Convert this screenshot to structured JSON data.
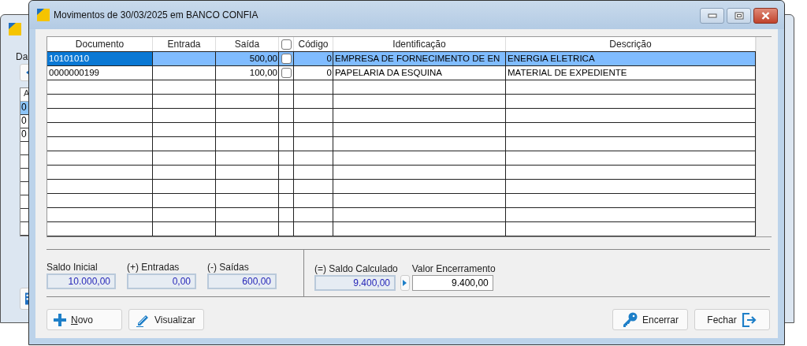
{
  "background_window": {
    "label": "Da",
    "column_header": "A",
    "rows": [
      {
        "cell": "0",
        "selected": true
      },
      {
        "cell": "0",
        "selected": false
      },
      {
        "cell": "0",
        "selected": false
      }
    ]
  },
  "window": {
    "title": "Movimentos de 30/03/2025 em BANCO CONFIA"
  },
  "table": {
    "header_checkbox": {
      "checked": false
    },
    "columns": [
      {
        "kind": "text",
        "label": "Documento"
      },
      {
        "kind": "text",
        "label": "Entrada"
      },
      {
        "kind": "text",
        "label": "Saída"
      },
      {
        "kind": "checkbox"
      },
      {
        "kind": "text",
        "label": "Código"
      },
      {
        "kind": "text",
        "label": "Identificação"
      },
      {
        "kind": "text",
        "label": "Descrição"
      }
    ],
    "rows": [
      {
        "selected": true,
        "documento": "10101010",
        "entrada": "",
        "saida": "500,00",
        "checked": false,
        "codigo": "0",
        "identificacao": "EMPRESA DE FORNECIMENTO DE EN",
        "descricao": "ENERGIA ELETRICA"
      },
      {
        "selected": false,
        "documento": "0000000199",
        "entrada": "",
        "saida": "100,00",
        "checked": false,
        "codigo": "0",
        "identificacao": "PAPELARIA DA ESQUINA",
        "descricao": "MATERIAL DE EXPEDIENTE"
      }
    ]
  },
  "totals": [
    {
      "label": "Saldo Inicial",
      "value": "10.000,00",
      "readonly": true
    },
    {
      "label": "(+) Entradas",
      "value": "0,00",
      "readonly": true
    },
    {
      "label": "(-) Saídas",
      "value": "600,00",
      "readonly": true
    }
  ],
  "closing": [
    {
      "label": "(=) Saldo Calculado",
      "value": "9.400,00",
      "readonly": true
    },
    {
      "label": "Valor Encerramento",
      "value": "9.400,00",
      "readonly": false
    }
  ],
  "buttons": [
    {
      "kind": "new",
      "label": "Novo",
      "mnemonic": true
    },
    {
      "kind": "view",
      "label": "Visualizar",
      "mnemonic": false
    },
    {
      "kind": "close-period",
      "label": "Encerrar",
      "mnemonic": false
    },
    {
      "kind": "exit",
      "label": "Fechar",
      "mnemonic": false
    }
  ]
}
